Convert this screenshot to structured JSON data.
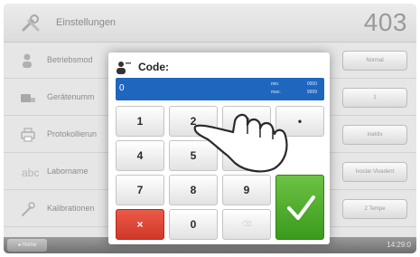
{
  "header": {
    "title": "Einstellungen",
    "program_number": "403"
  },
  "rows": [
    {
      "label": "Betriebsmod",
      "value": "Normal",
      "icon": "person-icon"
    },
    {
      "label": "Gerätenumm",
      "value": "1",
      "icon": "device-icon"
    },
    {
      "label": "Protokollierun",
      "value": "inaktiv",
      "icon": "printer-icon"
    },
    {
      "label": "Laborname",
      "value": "Ivoclar Vivadent",
      "icon": "abc-icon"
    },
    {
      "label": "Kalibrationen",
      "value": "2 Tempe",
      "icon": "calibration-icon"
    }
  ],
  "footer": {
    "home_label": "Home",
    "clock": "14:29:0"
  },
  "dialog": {
    "title": "Code:",
    "current_value": "0",
    "range_labels": [
      "min.",
      "max."
    ],
    "range_values": [
      "0000",
      "9999"
    ],
    "keys": [
      "1",
      "2",
      "3",
      "4",
      "5",
      "6",
      "7",
      "8",
      "9",
      "0"
    ],
    "cancel_symbol": "×",
    "delete_symbol": "⌫",
    "hidden_key_symbol": "•"
  },
  "colors": {
    "display_blue": "#1f66bf",
    "cancel_red": "#d03828",
    "ok_green": "#3a9a1c"
  }
}
